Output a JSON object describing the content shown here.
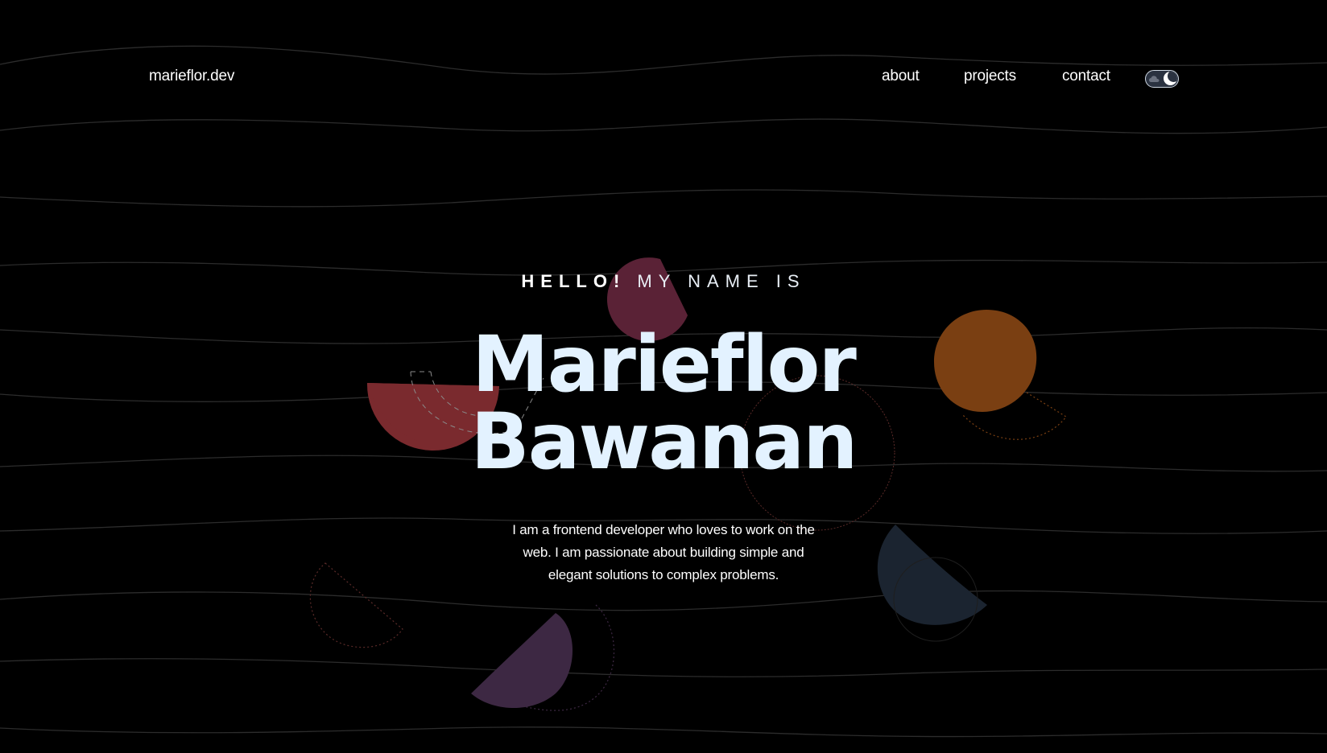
{
  "nav": {
    "logo": "marieflor.dev",
    "links": [
      {
        "label": "about"
      },
      {
        "label": "projects"
      },
      {
        "label": "contact"
      }
    ],
    "theme_toggle": {
      "state": "dark"
    }
  },
  "hero": {
    "greeting_bold": "HELLO!",
    "greeting_rest": "MY NAME IS",
    "first_name": "Marieflor",
    "last_name": "Bawanan",
    "bio": "I am a frontend developer who loves to work on the web. I am passionate about building simple and elegant solutions to complex problems."
  },
  "colors": {
    "background": "#000000",
    "name_text": "#e3f2ff",
    "shape_red": "#7a2a2e",
    "shape_plum": "#5a2236",
    "shape_orange": "#7a3f12",
    "shape_navy": "#1b2430",
    "shape_purple": "#3d2843",
    "wave_lines": "#2a2a2a"
  },
  "icons": {
    "toggle_left": "cloud-icon",
    "toggle_right": "moon-icon"
  }
}
